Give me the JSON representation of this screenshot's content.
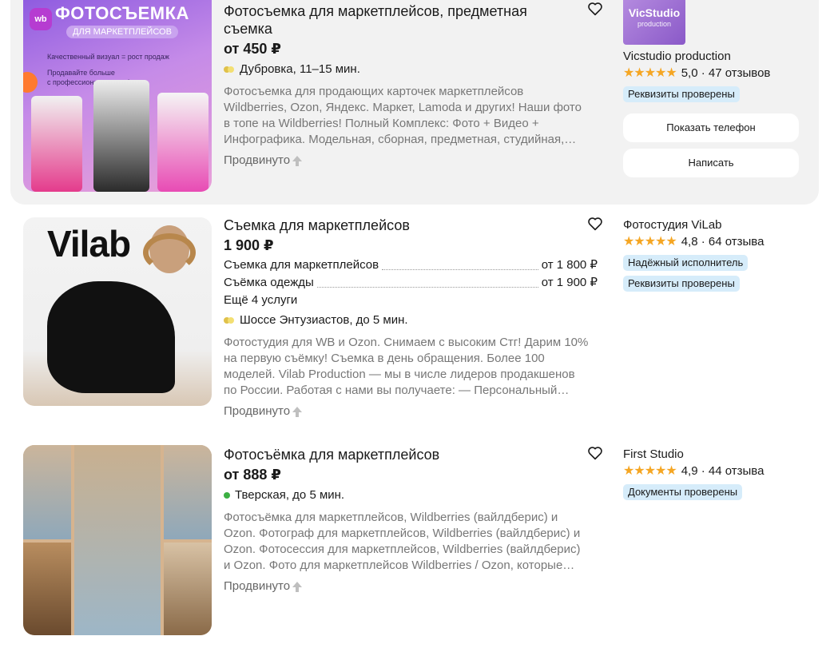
{
  "listings": [
    {
      "title": "Фотосъемка для маркетплейсов, предметная съемка",
      "price": "от 450 ₽",
      "location": "Дубровка, 11–15 мин.",
      "description_lines": [
        "Фотосъемка для продающих карточек маркетплейсов",
        "Wildberries, Ozon, Яндекс. Маркет, Lamoda и других! Наши фото",
        "в топе на Wildberries! Полный Комплекс: Фото + Видео +",
        "Инфографика. Модельная, сборная, предметная, студийная,…"
      ],
      "promo": "Продвинуто",
      "thumb_text": {
        "headline": "ФОТОСЪЕМКА",
        "subline": "ДЛЯ МАРКЕТПЛЕЙСОВ",
        "wb": "wb",
        "bullet1": "Качественный визуал = рост продаж",
        "bullet2": "Продавайте больше",
        "bullet3": "с профессиональными фото"
      },
      "seller": {
        "logo_line1": "VicStudio",
        "logo_line2": "production",
        "name": "Vicstudio production",
        "stars": "★★★★★",
        "rating": "5,0 · 47 отзывов",
        "badges": [
          "Реквизиты проверены"
        ],
        "phone_button": "Показать телефон",
        "write_button": "Написать"
      }
    },
    {
      "title": "Съемка для маркетплейсов",
      "price": "1 900 ₽",
      "services": [
        {
          "name": "Съемка для маркетплейсов",
          "price": "от 1 800 ₽"
        },
        {
          "name": "Съёмка одежды",
          "price": "от 1 900 ₽"
        }
      ],
      "more_services": "Ещё 4 услуги",
      "location": "Шоссе Энтузиастов, до 5 мин.",
      "description_lines": [
        "Фотостудия для WB и Ozon. Снимаем с высоким Стг! Дарим 10%",
        "на первую съёмку! Съемка в день обращения. Более 100",
        "моделей. Vilab Production — мы в числе лидеров продакшенов",
        "по России. Работая с нами вы получаете: — Персональный…"
      ],
      "promo": "Продвинуто",
      "thumb_text": {
        "logo": "Vilab"
      },
      "seller": {
        "name": "Фотостудия ViLab",
        "stars": "★★★★★",
        "rating": "4,8 · 64 отзыва",
        "badges": [
          "Надёжный исполнитель",
          "Реквизиты проверены"
        ]
      }
    },
    {
      "title": "Фотосъёмка для маркетплейсов",
      "price": "от 888 ₽",
      "location": "Тверская, до 5 мин.",
      "description_lines": [
        "Фотосъёмка для маркетплейсов, Wildberries (вайлдберис) и",
        "Ozon. Фотограф для маркетплейсов, Wildberries (вайлдберис) и",
        "Ozon. Фотосессия для маркетплейсов, Wildberries (вайлдберис)",
        "и Ozon. Фото для маркетплейсов Wildberries / Ozon, которые…"
      ],
      "promo": "Продвинуто",
      "seller": {
        "name": "First Studio",
        "stars": "★★★★★",
        "rating": "4,9 · 44 отзыва",
        "badges": [
          "Документы проверены"
        ]
      }
    }
  ],
  "colors": {
    "star": "#f5a623",
    "badge_bg": "#d6ecfa",
    "highlight_card": "#f2f2f2",
    "metro_yellow": "#e0c14a",
    "metro_green": "#3cb043"
  },
  "icons": [
    "heart-outline-icon",
    "metro-line-icon",
    "promoted-arrow-icon",
    "star-icon"
  ]
}
